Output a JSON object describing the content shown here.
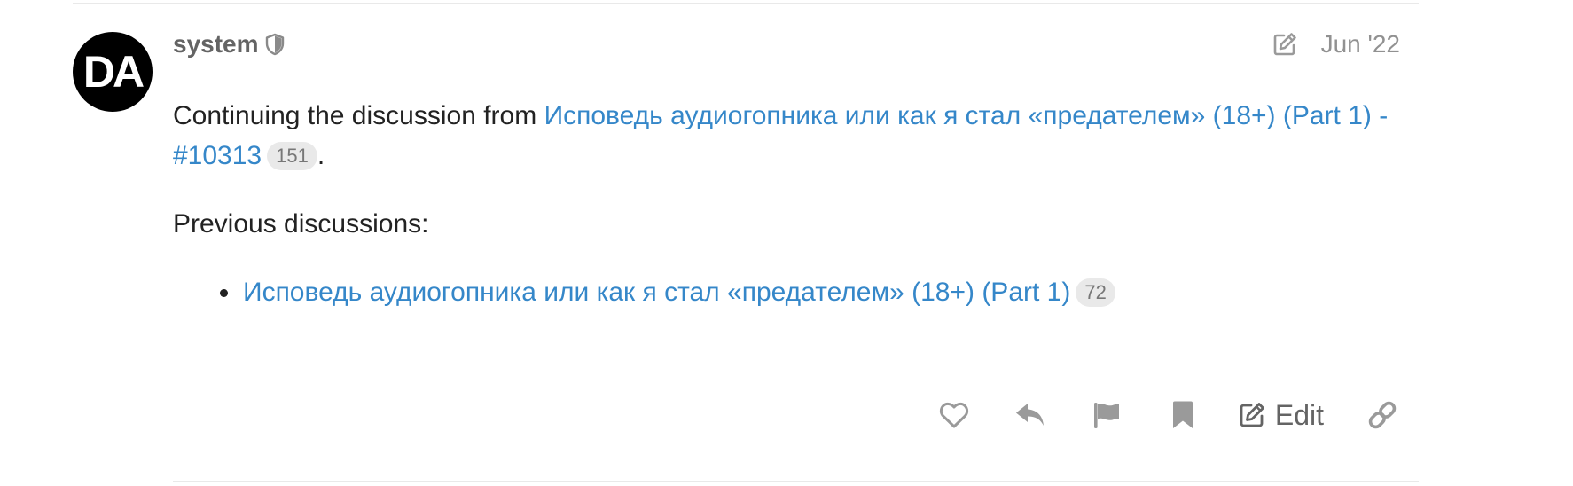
{
  "post": {
    "avatar_initials": "DA",
    "username": "system",
    "date": "Jun '22",
    "continuing_prefix": "Continuing the discussion from ",
    "continuing_link": "Исповедь аудиогопника или как я стал «предателем» (18+) (Part 1) - #10313",
    "continuing_clicks": "151",
    "continuing_suffix": ".",
    "previous_heading": "Previous discussions:",
    "previous_items": [
      {
        "title": "Исповедь аудиогопника или как я стал «предателем» (18+) (Part 1)",
        "clicks": "72"
      }
    ]
  },
  "actions": {
    "like": "like-icon",
    "reply": "reply-icon",
    "flag": "flag-icon",
    "bookmark": "bookmark-icon",
    "edit_label": "Edit",
    "share": "link-icon"
  },
  "colors": {
    "link": "#3587c9",
    "icon_gray": "#9a9a9a",
    "badge_bg": "#e9e9e9",
    "avatar_bg": "#000000"
  }
}
